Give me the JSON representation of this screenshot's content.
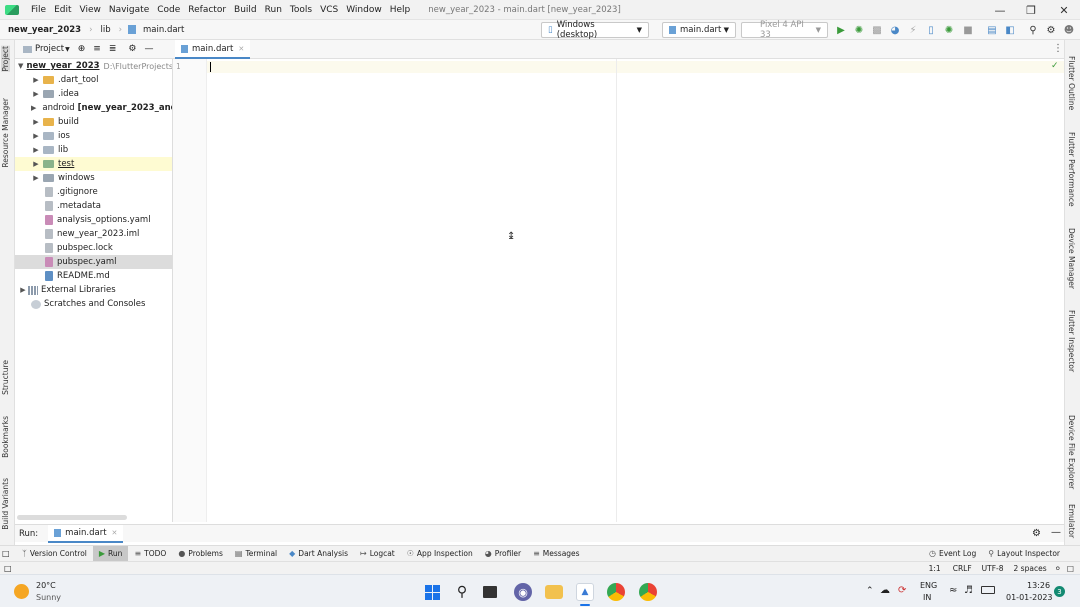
{
  "window": {
    "menus": [
      "File",
      "Edit",
      "View",
      "Navigate",
      "Code",
      "Refactor",
      "Build",
      "Run",
      "Tools",
      "VCS",
      "Window",
      "Help"
    ],
    "title": "new_year_2023 - main.dart [new_year_2023]"
  },
  "breadcrumb": {
    "project": "new_year_2023",
    "folder": "lib",
    "file": "main.dart"
  },
  "toolbar": {
    "device": "Windows (desktop)",
    "config": "main.dart",
    "emulator": "Pixel 4 API 33"
  },
  "left_strip": [
    "Project",
    "Resource Manager",
    "Structure",
    "Bookmarks",
    "Build Variants"
  ],
  "right_strip": [
    "Flutter Outline",
    "Flutter Performance",
    "Device Manager",
    "Flutter Inspector",
    "Device File Explorer",
    "Emulator"
  ],
  "project_panel": {
    "view_label": "Project"
  },
  "tree": {
    "root": {
      "name": "new_year_2023",
      "path": "D:\\FlutterProjects"
    },
    "items": [
      {
        "label": ".dart_tool",
        "kind": "folder-orange"
      },
      {
        "label": ".idea",
        "kind": "folder"
      },
      {
        "label": "android",
        "suffix": "[new_year_2023_and",
        "kind": "folder"
      },
      {
        "label": "build",
        "kind": "folder-orange"
      },
      {
        "label": "ios",
        "kind": "folder"
      },
      {
        "label": "lib",
        "kind": "folder"
      },
      {
        "label": "test",
        "kind": "folder"
      },
      {
        "label": "windows",
        "kind": "folder"
      },
      {
        "label": ".gitignore",
        "kind": "file"
      },
      {
        "label": ".metadata",
        "kind": "file"
      },
      {
        "label": "analysis_options.yaml",
        "kind": "file"
      },
      {
        "label": "new_year_2023.iml",
        "kind": "file"
      },
      {
        "label": "pubspec.lock",
        "kind": "file"
      },
      {
        "label": "pubspec.yaml",
        "kind": "file"
      },
      {
        "label": "README.md",
        "kind": "file"
      },
      {
        "label": "External Libraries",
        "kind": "lib"
      },
      {
        "label": "Scratches and Consoles",
        "kind": "scratch"
      }
    ]
  },
  "editor": {
    "tab": "main.dart",
    "line_number": "1"
  },
  "run_bar": {
    "label": "Run:",
    "config": "main.dart"
  },
  "tool_windows": [
    "Version Control",
    "Run",
    "TODO",
    "Problems",
    "Terminal",
    "Dart Analysis",
    "Logcat",
    "App Inspection",
    "Profiler",
    "Messages"
  ],
  "tool_windows_right": [
    "Event Log",
    "Layout Inspector"
  ],
  "status": {
    "position": "1:1",
    "line_sep": "CRLF",
    "encoding": "UTF-8",
    "indent": "2 spaces"
  },
  "taskbar": {
    "weather_temp": "20°C",
    "weather_desc": "Sunny",
    "lang_1": "ENG",
    "lang_2": "IN",
    "time": "13:26",
    "date": "01-01-2023",
    "notif_count": "3"
  },
  "colors": {
    "accent": "#4a88c7",
    "run_green": "#3a9a3a",
    "folder_orange": "#e8b34b"
  }
}
